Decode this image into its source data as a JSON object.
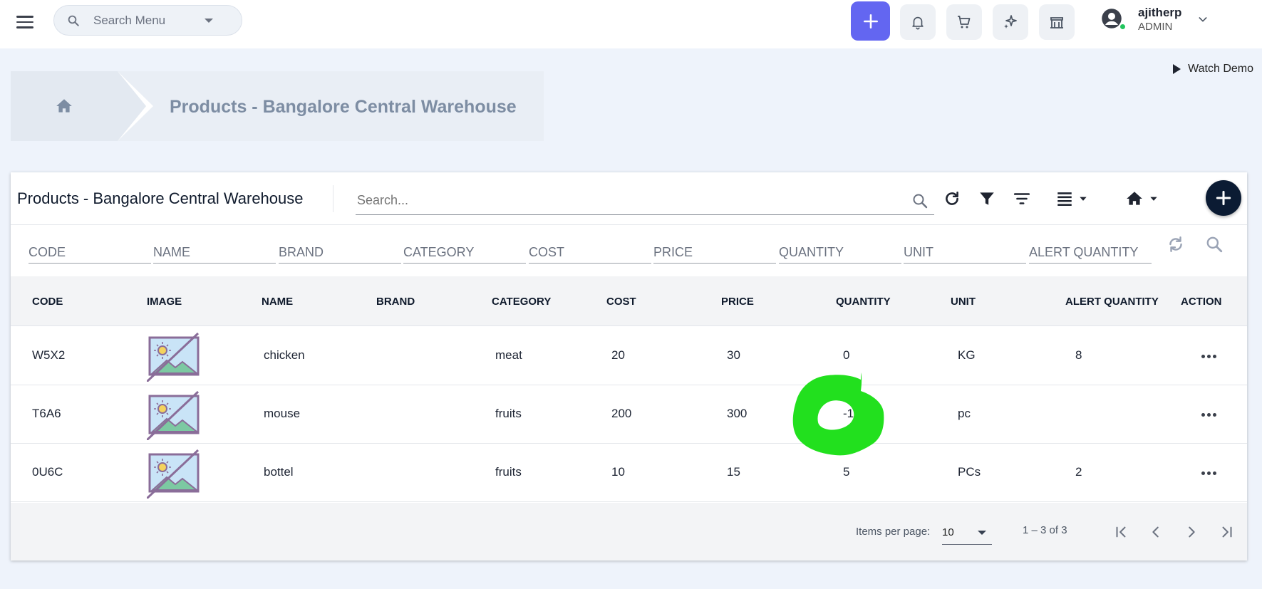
{
  "topbar": {
    "search_placeholder": "Search Menu",
    "user_name": "ajitherp",
    "user_role": "ADMIN"
  },
  "watch_demo": "Watch Demo",
  "breadcrumb": {
    "title": "Products - Bangalore Central Warehouse"
  },
  "card": {
    "title": "Products - Bangalore Central Warehouse",
    "search_placeholder": "Search..."
  },
  "filters": [
    "CODE",
    "NAME",
    "BRAND",
    "CATEGORY",
    "COST",
    "PRICE",
    "QUANTITY",
    "UNIT",
    "ALERT QUANTITY"
  ],
  "columns": [
    "CODE",
    "IMAGE",
    "NAME",
    "BRAND",
    "CATEGORY",
    "COST",
    "PRICE",
    "QUANTITY",
    "UNIT",
    "ALERT QUANTITY",
    "ACTION"
  ],
  "rows": [
    {
      "code": "W5X2",
      "name": "chicken",
      "brand": "",
      "category": "meat",
      "cost": "20",
      "price": "30",
      "quantity": "0",
      "unit": "KG",
      "alert_quantity": "8"
    },
    {
      "code": "T6A6",
      "name": "mouse",
      "brand": "",
      "category": "fruits",
      "cost": "200",
      "price": "300",
      "quantity": "-1",
      "unit": "pc",
      "alert_quantity": ""
    },
    {
      "code": "0U6C",
      "name": "bottel",
      "brand": "",
      "category": "fruits",
      "cost": "10",
      "price": "15",
      "quantity": "5",
      "unit": "PCs",
      "alert_quantity": "2"
    }
  ],
  "paginator": {
    "items_per_page_label": "Items per page:",
    "page_size": "10",
    "range": "1 – 3 of 3"
  },
  "colors": {
    "accent": "#6366f1",
    "fab": "#0b1b33",
    "marker": "#22e01e",
    "online": "#22c55e"
  }
}
